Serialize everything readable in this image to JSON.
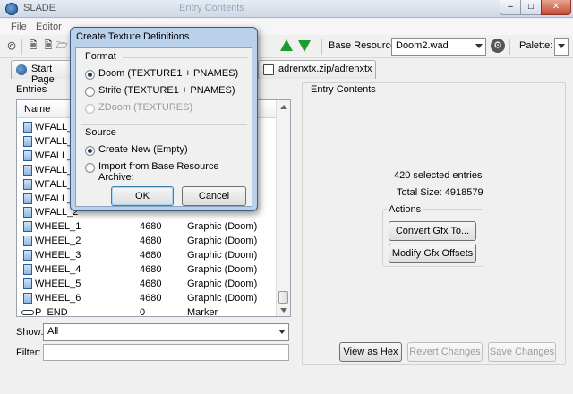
{
  "window": {
    "title": "SLADE",
    "ghost_title": "Entry Contents"
  },
  "menu": [
    "File",
    "Editor"
  ],
  "toolbar": {
    "base_resource_label": "Base Resource:",
    "base_resource_value": "Doom2.wad",
    "palette_label": "Palette:"
  },
  "tabs": [
    {
      "label": "Start Page"
    },
    {
      "label": "adrenxtx.zip/adrenxtx"
    }
  ],
  "left": {
    "entries_label": "Entries",
    "columns": [
      "Name"
    ],
    "rows": [
      {
        "name": "WFALL_1",
        "size": "",
        "type": ""
      },
      {
        "name": "WFALL_1",
        "size": "",
        "type": ""
      },
      {
        "name": "WFALL_2",
        "size": "",
        "type": ""
      },
      {
        "name": "WFALL_2",
        "size": "",
        "type": ""
      },
      {
        "name": "WFALL_2",
        "size": "",
        "type": ""
      },
      {
        "name": "WFALL_2",
        "size": "",
        "type": ""
      },
      {
        "name": "WFALL_2",
        "size": "",
        "type": ""
      },
      {
        "name": "WHEEL_1",
        "size": "4680",
        "type": "Graphic (Doom)"
      },
      {
        "name": "WHEEL_2",
        "size": "4680",
        "type": "Graphic (Doom)"
      },
      {
        "name": "WHEEL_3",
        "size": "4680",
        "type": "Graphic (Doom)"
      },
      {
        "name": "WHEEL_4",
        "size": "4680",
        "type": "Graphic (Doom)"
      },
      {
        "name": "WHEEL_5",
        "size": "4680",
        "type": "Graphic (Doom)"
      },
      {
        "name": "WHEEL_6",
        "size": "4680",
        "type": "Graphic (Doom)"
      },
      {
        "name": "P_END",
        "size": "0",
        "type": "Marker"
      }
    ],
    "show_label": "Show:",
    "show_value": "All",
    "filter_label": "Filter:",
    "filter_value": ""
  },
  "right": {
    "title": "Entry Contents",
    "selected_text": "420 selected entries",
    "total_size_text": "Total Size: 4918579",
    "actions_label": "Actions",
    "convert_button": "Convert Gfx To...",
    "modify_button": "Modify Gfx Offsets",
    "view_hex_button": "View as Hex",
    "revert_button": "Revert Changes",
    "save_button": "Save Changes"
  },
  "dialog": {
    "title": "Create Texture Definitions",
    "format_label": "Format",
    "format_options": [
      {
        "label": "Doom (TEXTURE1 + PNAMES)",
        "selected": true,
        "disabled": false
      },
      {
        "label": "Strife (TEXTURE1 + PNAMES)",
        "selected": false,
        "disabled": false
      },
      {
        "label": "ZDoom (TEXTURES)",
        "selected": false,
        "disabled": true
      }
    ],
    "source_label": "Source",
    "source_options": [
      {
        "label": "Create New (Empty)",
        "selected": true
      },
      {
        "label": "Import from Base Resource Archive:",
        "selected": false
      }
    ],
    "ok": "OK",
    "cancel": "Cancel"
  },
  "colors": {
    "accent_green": "#1f9a2e",
    "dialog_frame": "#b9d1ea"
  }
}
